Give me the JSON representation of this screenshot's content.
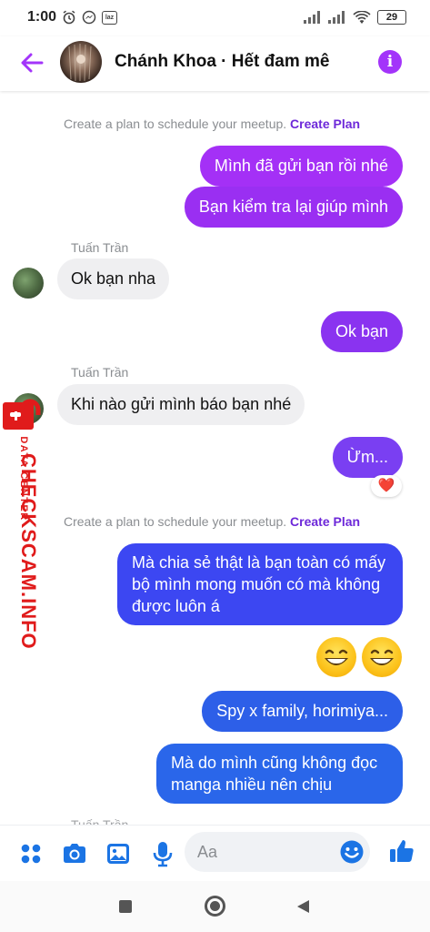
{
  "status_bar": {
    "time": "1:00",
    "battery": "29",
    "lazada_label": "laz"
  },
  "header": {
    "title": "Chánh Khoa · Hết đam mê"
  },
  "chat": {
    "system_note_1": {
      "text": "Create a plan to schedule your meetup.",
      "link": "Create Plan"
    },
    "msg_out_1": "Mình đã gửi bạn rồi nhé",
    "msg_out_2": "Bạn kiểm tra lại giúp mình",
    "sender_1": "Tuấn Trần",
    "msg_in_1": "Ok bạn nha",
    "msg_out_3": "Ok bạn",
    "sender_2": "Tuấn Trần",
    "msg_in_2": "Khi nào gửi mình báo bạn nhé",
    "msg_out_4": "Ừm...",
    "reaction_4": "❤️",
    "system_note_2": {
      "text": "Create a plan to schedule your meetup.",
      "link": "Create Plan"
    },
    "msg_out_5": "Mà chia sẻ thật là bạn toàn có mấy bộ mình mong muốn có mà không được luôn á",
    "msg_out_7": "Spy x family, horimiya...",
    "msg_out_8": "Mà do mình cũng không đọc manga nhiều nên chịu",
    "sender_3": "Tuấn Trần"
  },
  "watermark": {
    "brand": "CHECKSCAM.INFO",
    "sub": "DATA CENTER"
  },
  "composer": {
    "placeholder": "Aa"
  },
  "colors": {
    "accent": "#a334fa",
    "bubble_purple": "#9b2ff0",
    "bubble_blue": "#3a4ff5",
    "incoming": "#efeff1",
    "watermark": "#e01b1b"
  },
  "icons": [
    "back-arrow-icon",
    "info-icon",
    "apps-icon",
    "camera-icon",
    "gallery-icon",
    "mic-icon",
    "emoji-icon",
    "like-icon",
    "heart-icon"
  ]
}
